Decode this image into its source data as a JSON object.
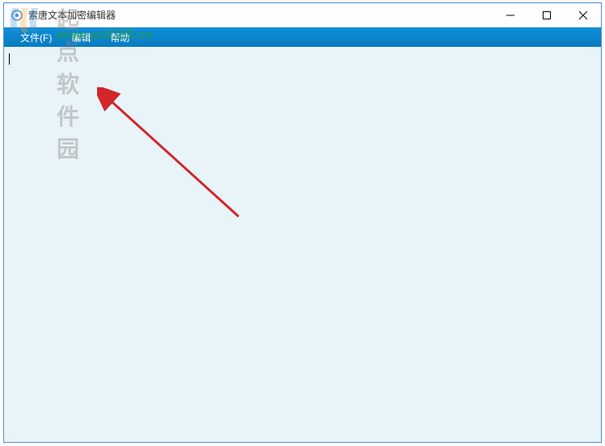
{
  "window": {
    "title": "索唐文本加密编辑器"
  },
  "menubar": {
    "items": [
      {
        "label": "文件(F)"
      },
      {
        "label": "编辑"
      },
      {
        "label": "帮助"
      }
    ]
  },
  "watermark": {
    "text_cn": "起点软件园",
    "url": "www.pc0359.cn"
  },
  "colors": {
    "menubar_bg": "#0d8fd8",
    "content_bg": "#e8f4f8",
    "arrow": "#d4252a"
  }
}
